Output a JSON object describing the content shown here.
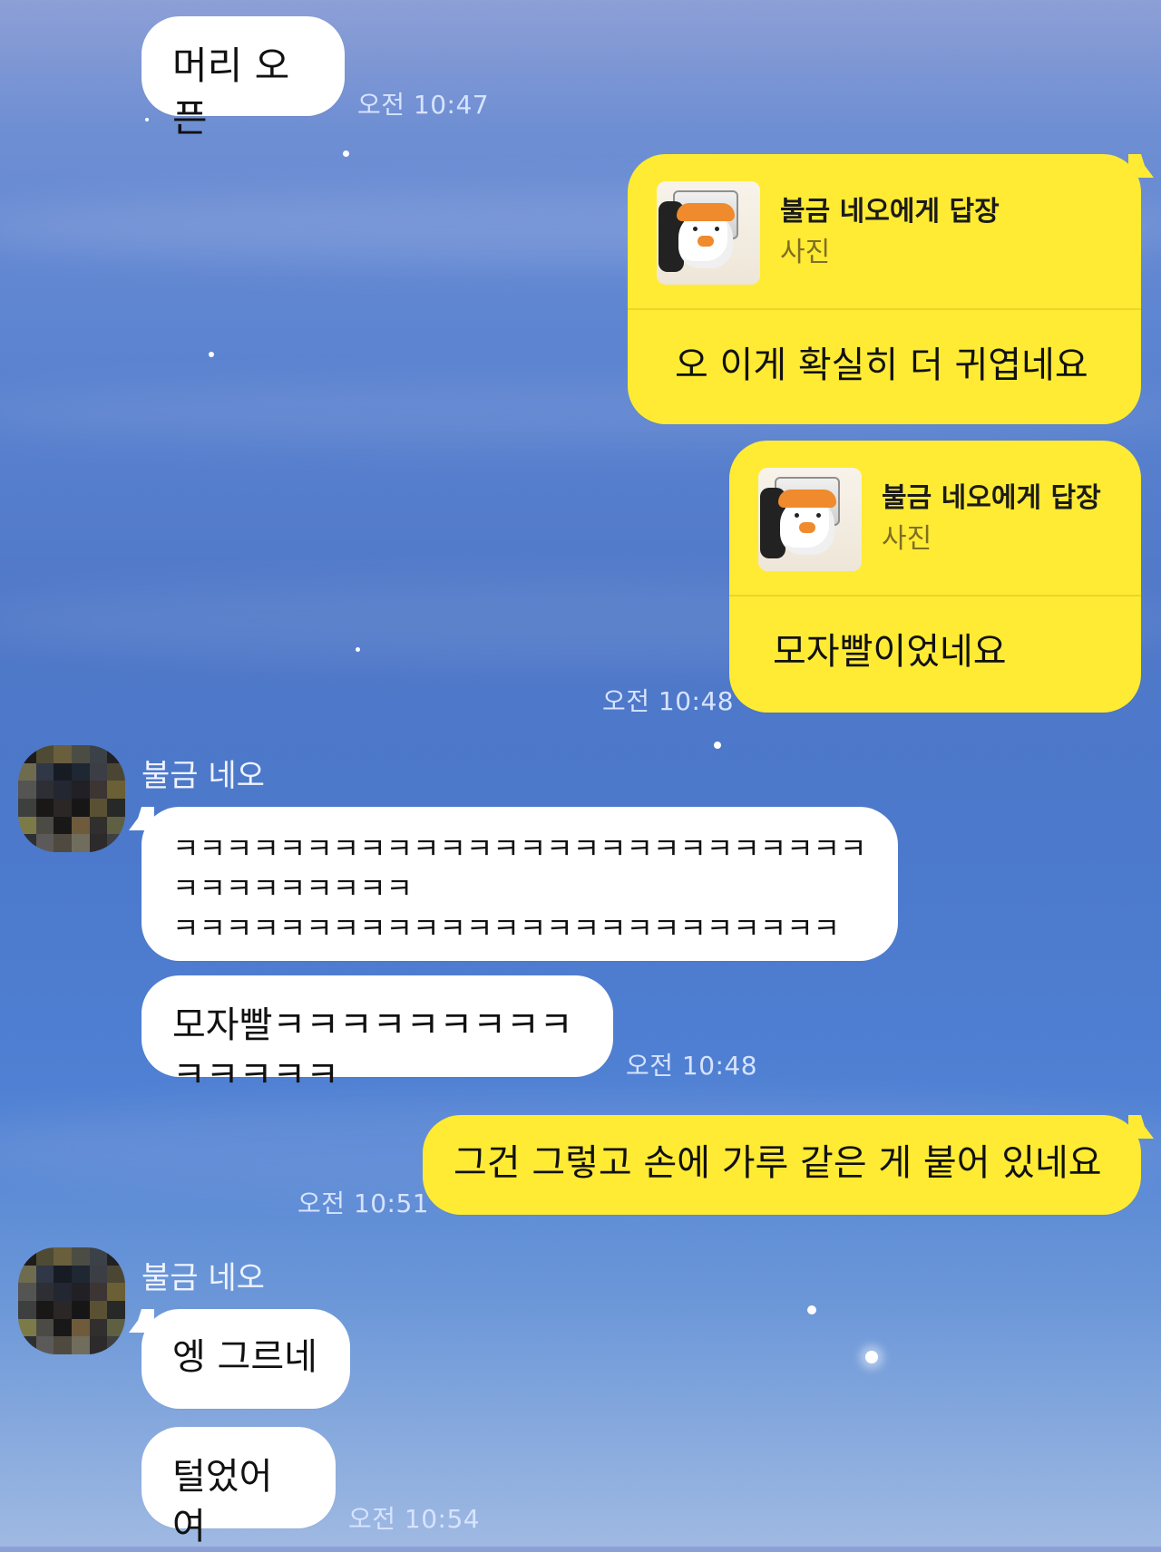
{
  "chat": {
    "messages": [
      {
        "id": "m1",
        "text": "머리 오픈",
        "time": "오전 10:47"
      },
      {
        "id": "m2",
        "reply_title": "불금 네오에게 답장",
        "reply_subtitle": "사진",
        "text": "오 이게 확실히 더 귀엽네요"
      },
      {
        "id": "m3",
        "reply_title": "불금 네오에게 답장",
        "reply_subtitle": "사진",
        "text": "모자빨이었네요",
        "time": "오전 10:48"
      },
      {
        "id": "m4",
        "sender": "불금 네오",
        "text": "ㅋㅋㅋㅋㅋㅋㅋㅋㅋㅋㅋㅋㅋㅋㅋㅋㅋㅋㅋㅋㅋㅋㅋㅋㅋㅋㅋㅋㅋㅋㅋㅋㅋㅋㅋ\nㅋㅋㅋㅋㅋㅋㅋㅋㅋㅋㅋㅋㅋㅋㅋㅋㅋㅋㅋㅋㅋㅋㅋㅋㅋ"
      },
      {
        "id": "m5",
        "text": "모자빨ㅋㅋㅋㅋㅋㅋㅋㅋㅋㅋㅋㅋㅋㅋ",
        "time": "오전 10:48"
      },
      {
        "id": "m6",
        "text": "그건 그렇고 손에 가루 같은 게 붙어 있네요",
        "time": "오전 10:51"
      },
      {
        "id": "m7",
        "sender": "불금 네오",
        "text": "엥 그르네"
      },
      {
        "id": "m8",
        "text": "털었어여",
        "time": "오전 10:54"
      }
    ]
  }
}
